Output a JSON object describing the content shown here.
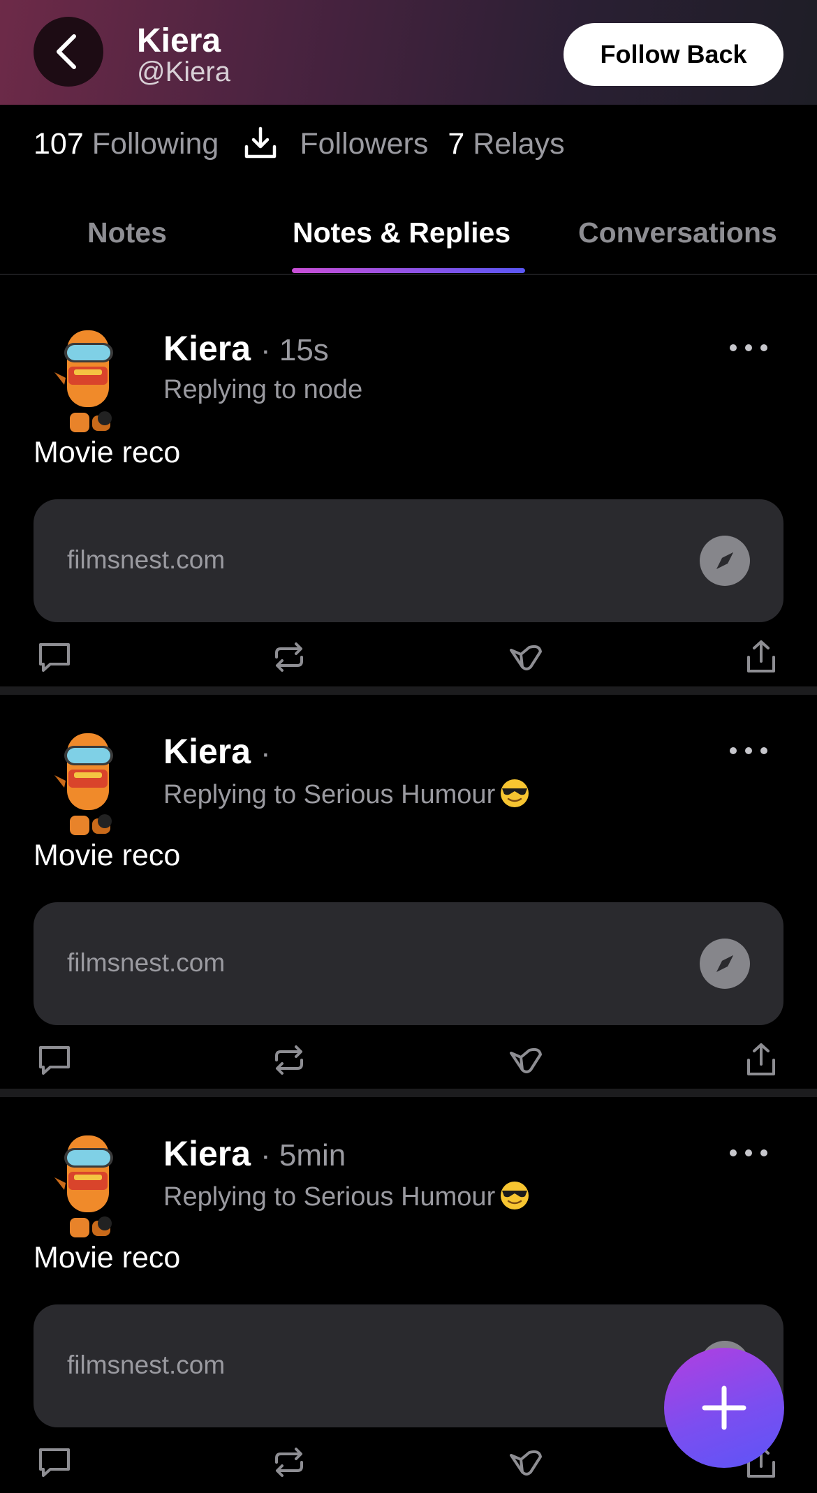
{
  "header": {
    "name": "Kiera",
    "handle": "@Kiera",
    "follow_label": "Follow Back"
  },
  "stats": {
    "following_count": "107",
    "following_label": "Following",
    "followers_label": "Followers",
    "relays_count": "7",
    "relays_label": "Relays"
  },
  "tabs": [
    {
      "label": "Notes"
    },
    {
      "label": "Notes & Replies",
      "active": true
    },
    {
      "label": "Conversations"
    }
  ],
  "notes": [
    {
      "author": "Kiera",
      "time": "· 15s",
      "replying": "Replying to node",
      "emoji": "",
      "text": "Movie reco",
      "link": "filmsnest.com"
    },
    {
      "author": "Kiera",
      "time": "·",
      "replying": "Replying to Serious Humour",
      "emoji": "sunglasses-face",
      "text": "Movie reco",
      "link": "filmsnest.com"
    },
    {
      "author": "Kiera",
      "time": "· 5min",
      "replying": "Replying to Serious Humour",
      "emoji": "sunglasses-face",
      "text": "Movie reco",
      "link": "filmsnest.com"
    }
  ],
  "icons": [
    "back-arrow-icon",
    "download-icon",
    "more-icon",
    "compass-icon",
    "reply-icon",
    "repost-icon",
    "zap-icon",
    "share-icon",
    "plus-icon"
  ],
  "colors": {
    "accent_start": "#c94fd6",
    "accent_end": "#5a57f5",
    "card_bg": "#2a2a2e"
  }
}
